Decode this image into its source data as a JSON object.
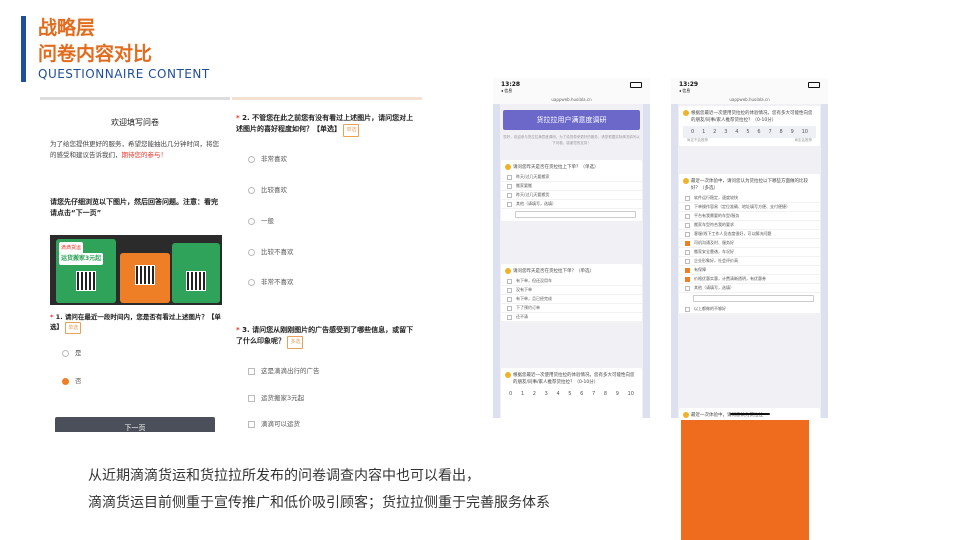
{
  "header": {
    "title_line1": "战略层",
    "title_line2": "问卷内容对比",
    "subtitle_en": "QUESTIONNAIRE CONTENT"
  },
  "didi_survey": {
    "welcome_title": "欢迎填写问卷",
    "intro_text": "为了给您提供更好的服务，希望您能抽出几分钟时间，将您的感受和建议告诉我们，",
    "intro_highlight": "期待您的参与！",
    "instruction": "请您先仔细浏览以下图片，然后回答问题。注意：看完请点击“下一页”",
    "ad_badge": "滴滴货运",
    "ad_headline": "运货搬家3元起",
    "q1_text": "1. 请问在最近一段时间内，您是否有看过上述图片？【单选】",
    "q1_tag": "单选",
    "q1_options": [
      "是",
      "否"
    ],
    "q1_selected_index": 1,
    "next_button": "下一页",
    "q2_text": "2. 不管您在此之前您有没有看过上述图片，请问您对上述图片的喜好程度如何？【单选】",
    "q2_tag": "单选",
    "q2_options": [
      "非常喜欢",
      "比较喜欢",
      "一般",
      "比较不喜欢",
      "非常不喜欢"
    ],
    "q3_text": "3. 请问您从刚刚图片的广告感受到了哪些信息，或留下了什么印象呢？",
    "q3_tag": "多选",
    "q3_options": [
      "这是滴滴出行的广告",
      "运货搬家3元起",
      "滴滴可以运货"
    ]
  },
  "huolala_phone1": {
    "time": "13:28",
    "back": "◂ 信息",
    "url": "uappweb.huolala.cn",
    "banner": "货拉拉用户满意度调研",
    "description": "您好，欢迎参与货拉拉满意度调研。为了给您带来更好的服务，请您根据实际情况填写以下问卷，感谢您的支持！",
    "card1_question": "请问您昨天是否在货拉拉上下单？（单选）",
    "card1_options": [
      "昨天/过几天要搬家",
      "搬家要搬",
      "昨天/过几天要搬货",
      "其他（请填写，选填）"
    ],
    "card2_question": "请问您昨天是否在货拉拉下单？（单选）",
    "card2_options": [
      "有下单，但还没用车",
      "没有下单",
      "有下单，且已经完成",
      "下了预约订单",
      "还不清"
    ],
    "card3_question": "根据您最近一次使用货拉拉的体验情况，您有多大可能性向您的朋友/同事/家人推荐货拉拉？（0-10分）",
    "scale": [
      "0",
      "1",
      "2",
      "3",
      "4",
      "5",
      "6",
      "7",
      "8",
      "9",
      "10"
    ]
  },
  "huolala_phone2": {
    "time": "13:29",
    "back": "◂ 信息",
    "url": "uappweb.huolala.cn",
    "card1_question": "根据您最近一次使用货拉拉的体验情况，您有多大可能性向您的朋友/同事/家人推荐货拉拉？（0-10分）",
    "scale": [
      "0",
      "1",
      "2",
      "3",
      "4",
      "5",
      "6",
      "7",
      "8",
      "9",
      "10"
    ],
    "scale_low": "肯定不会推荐",
    "scale_high": "肯定会推荐",
    "card2_question": "最近一次体验中，请问您认为货拉拉以下哪些方面做的比较好？（多选）",
    "card2_options": [
      {
        "label": "软件运行稳定，速度较快",
        "checked": false
      },
      {
        "label": "下单操作容易（定位准确、地址填写方便、支付便捷）",
        "checked": false
      },
      {
        "label": "平台有我需要的车型/服务",
        "checked": false
      },
      {
        "label": "搬家车型符合我的要求",
        "checked": false
      },
      {
        "label": "客服/线下工作人员态度很好，可以解决问题",
        "checked": false
      },
      {
        "label": "司机沟通及时、服务好",
        "checked": true
      },
      {
        "label": "搬家安全靠谱，车况好",
        "checked": false
      },
      {
        "label": "企业形象好，社会评价高",
        "checked": false
      },
      {
        "label": "有保障",
        "checked": true
      },
      {
        "label": "价格优惠实惠，计费清晰透明，有优惠券",
        "checked": true
      },
      {
        "label": "其他（请填写，选填）",
        "checked": false
      },
      {
        "label": "以上都做的不够好",
        "checked": false
      }
    ],
    "card3_question": "最近一次体验中，请问您认为货拉拉"
  },
  "caption": {
    "line1": "从近期滴滴货运和货拉拉所发布的问卷调查内容中也可以看出，",
    "line2": "滴滴货运目前侧重于宣传推广和低价吸引顾客；货拉拉侧重于完善服务体系"
  }
}
